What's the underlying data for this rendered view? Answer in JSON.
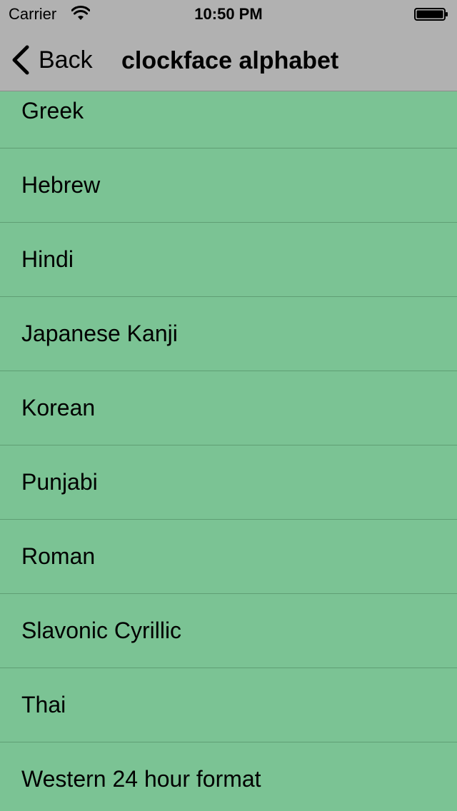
{
  "status_bar": {
    "carrier": "Carrier",
    "time": "10:50 PM",
    "wifi_icon": "wifi-icon",
    "battery_icon": "battery-icon"
  },
  "nav": {
    "back_label": "Back",
    "title": "clockface alphabet",
    "back_icon": "chevron-left-icon"
  },
  "list": {
    "items": [
      "Greek",
      "Hebrew",
      "Hindi",
      "Japanese Kanji",
      "Korean",
      "Punjabi",
      "Roman",
      "Slavonic Cyrillic",
      "Thai",
      "Western 24 hour format"
    ]
  },
  "colors": {
    "list_background": "#7bc394",
    "navbar_background": "#b1b1b1",
    "separator": "#5f9f74"
  }
}
